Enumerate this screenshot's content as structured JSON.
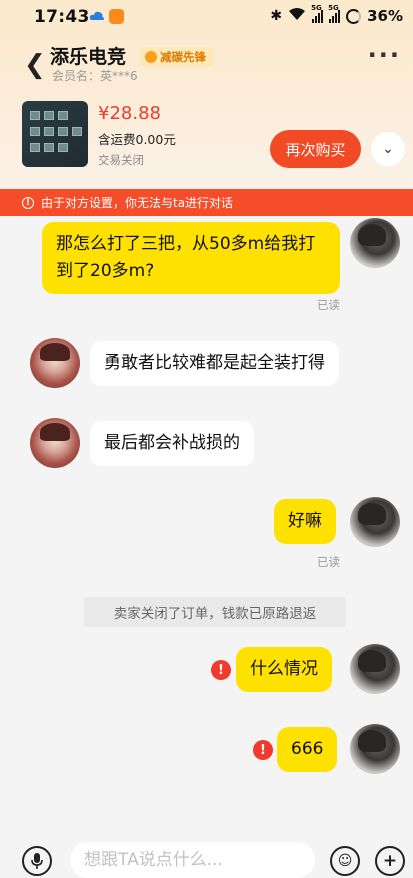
{
  "status_bar": {
    "time": "17:43",
    "net1": "5G",
    "net2": "5G",
    "battery": "36%"
  },
  "header": {
    "shop_name": "添乐电竞",
    "badge": "减碳先锋",
    "member": "会员名：英***6"
  },
  "order": {
    "price": "¥28.88",
    "shipping": "含运费0.00元",
    "status": "交易关闭",
    "rebuy_label": "再次购买"
  },
  "warning": "由于对方设置，你无法与ta进行对话",
  "messages": {
    "m1": "那怎么打了三把，从50多m给我打到了20多m?",
    "m1_read": "已读",
    "m2": "勇敢者比较难都是起全装打得",
    "m3": "最后都会补战损的",
    "m4": "好嘛",
    "m4_read": "已读",
    "system": "卖家关闭了订单，钱款已原路退返",
    "m5": "什么情况",
    "m6": "666"
  },
  "input": {
    "placeholder": "想跟TA说点什么..."
  },
  "colors": {
    "accent": "#f14a24",
    "my_bubble": "#ffe100",
    "price": "#ef3c2f"
  }
}
